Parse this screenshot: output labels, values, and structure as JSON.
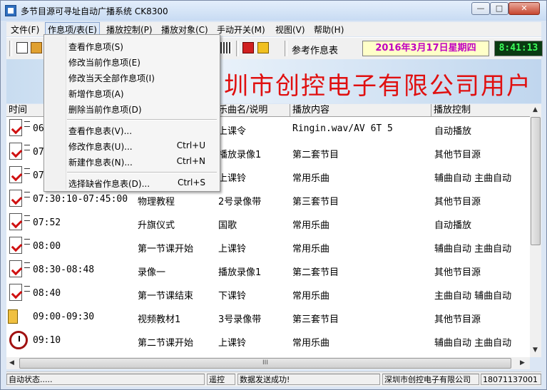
{
  "window": {
    "title": "多节目源可寻址自动广播系统 CK8300"
  },
  "menubar": {
    "items": [
      {
        "label": "文件(F)"
      },
      {
        "label": "作息项/表(E)"
      },
      {
        "label": "播放控制(P)"
      },
      {
        "label": "播放对象(C)"
      },
      {
        "label": "手动开关(M)"
      },
      {
        "label": "视图(V)"
      },
      {
        "label": "帮助(H)"
      }
    ]
  },
  "toolbar": {
    "ref_label": "参考作息表",
    "date": "2016年3月17日星期四",
    "time": "8:41:13"
  },
  "banner": {
    "text": "圳市创控电子有限公司用户"
  },
  "dropdown": {
    "items": [
      {
        "label": "查看作息项(S)",
        "shortcut": ""
      },
      {
        "label": "修改当前作息项(E)",
        "shortcut": ""
      },
      {
        "label": "修改当天全部作息项(I)",
        "shortcut": ""
      },
      {
        "label": "新增作息项(A)",
        "shortcut": ""
      },
      {
        "label": "删除当前作息项(D)",
        "shortcut": ""
      },
      {
        "label": "查看作息表(V)...",
        "shortcut": ""
      },
      {
        "label": "修改作息表(U)...",
        "shortcut": "Ctrl+U"
      },
      {
        "label": "新建作息表(N)...",
        "shortcut": "Ctrl+N"
      },
      {
        "label": "选择缺省作息表(D)...",
        "shortcut": "Ctrl+S"
      }
    ]
  },
  "table": {
    "columns": [
      "时间",
      "乐曲名/说明",
      "播放内容",
      "播放控制"
    ],
    "rows": [
      {
        "icon": "doc-check-icon",
        "time": "06",
        "name": "",
        "music": "上课令",
        "content": "Ringin.wav/AV 6T 5",
        "control": "自动播放"
      },
      {
        "icon": "doc-check-icon",
        "time": "07",
        "name": "",
        "music": "播放录像1",
        "content": "第二套节目",
        "control": "其他节目源"
      },
      {
        "icon": "doc-check-icon",
        "time": "07",
        "name": "",
        "music": "上课铃",
        "content": "常用乐曲",
        "control": "辅曲自动 主曲自动"
      },
      {
        "icon": "doc-check-icon",
        "time": "07:30:10-07:45:00",
        "name": "物理教程",
        "music": "2号录像带",
        "content": "第三套节目",
        "control": "其他节目源"
      },
      {
        "icon": "doc-check-icon",
        "time": "07:52",
        "name": "升旗仪式",
        "music": "国歌",
        "content": "常用乐曲",
        "control": "自动播放"
      },
      {
        "icon": "doc-check-icon",
        "time": "08:00",
        "name": "第一节课开始",
        "music": "上课铃",
        "content": "常用乐曲",
        "control": "辅曲自动 主曲自动"
      },
      {
        "icon": "doc-check-icon",
        "time": "08:30-08:48",
        "name": "录像一",
        "music": "播放录像1",
        "content": "第二套节目",
        "control": "其他节目源"
      },
      {
        "icon": "doc-check-icon",
        "time": "08:40",
        "name": "第一节课结束",
        "music": "下课铃",
        "content": "常用乐曲",
        "control": "主曲自动 辅曲自动"
      },
      {
        "icon": "speaker-clock-icon",
        "time": "09:00-09:30",
        "name": "视频教材1",
        "music": "3号录像带",
        "content": "第三套节目",
        "control": "其他节目源"
      },
      {
        "icon": "clock-icon",
        "time": "09:10",
        "name": "第二节课开始",
        "music": "上课铃",
        "content": "常用乐曲",
        "control": "辅曲自动 主曲自动"
      }
    ]
  },
  "hscroll": {
    "grip": "III"
  },
  "statusbar": {
    "status": "自动状态.....",
    "remote": "遥控",
    "message": "数据发送成功!",
    "company": "深圳市创控电子有限公司",
    "phone": "18071137001"
  }
}
